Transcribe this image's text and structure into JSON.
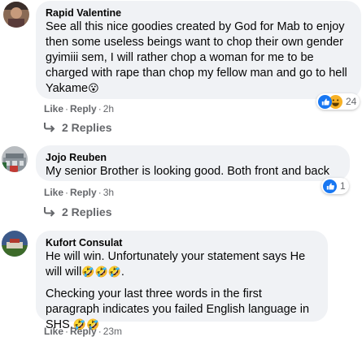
{
  "comments": [
    {
      "author": "Rapid Valentine",
      "text": "See all this nice goodies created by God for Mab to enjoy then some useless beings want to chop their own gender gyimiii sem, I will rather chop a woman for me to be charged with rape than chop my fellow man and go to hell Yakame",
      "text_emoji": "😮",
      "like_label": "Like",
      "reply_label": "Reply",
      "time": "2h",
      "reaction_count": "24",
      "reaction_icons": [
        "like-icon",
        "haha-icon"
      ],
      "replies_label": "2 Replies"
    },
    {
      "author": "Jojo Reuben",
      "text": "My senior Brother is looking good. Both front and back",
      "like_label": "Like",
      "reply_label": "Reply",
      "time": "3h",
      "reaction_count": "1",
      "reaction_icons": [
        "like-icon"
      ],
      "replies_label": "2 Replies"
    },
    {
      "author": "Kufort Consulat",
      "paragraph1": "He will win. Unfortunately your statement says He will will",
      "paragraph1_emoji": "🤣🤣🤣",
      "paragraph1_end": ".",
      "paragraph2": "Checking your last three words in the first paragraph indicates you failed English language in SHS.",
      "paragraph2_emoji": "🤣🤣",
      "like_label": "Like",
      "reply_label": "Reply",
      "time": "23m"
    }
  ],
  "colors": {
    "bubble": "#f0f2f5",
    "secondary_text": "#65676b",
    "like_blue": "#1877f2",
    "haha_yellow": "#f7b125"
  }
}
